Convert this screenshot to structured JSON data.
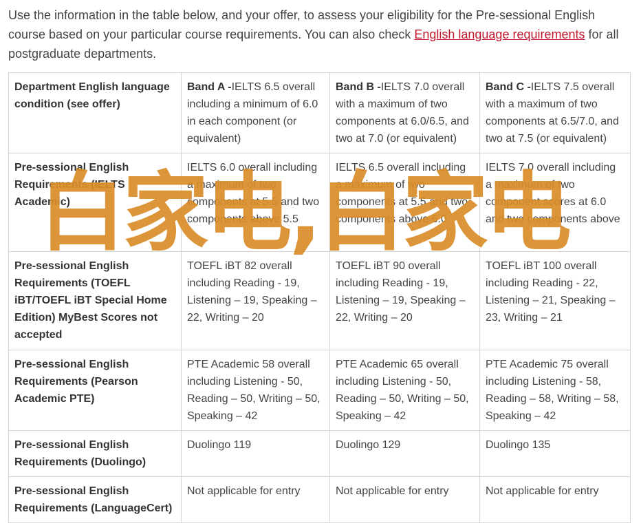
{
  "intro": {
    "before_link": "Use the information in the table below, and your offer, to assess your eligibility for the Pre-sessional English course based on your particular course requirements. You can also check ",
    "link_text": "English language requirements",
    "after_link": " for all postgraduate departments."
  },
  "table": {
    "header": {
      "first": "Department English language condition (see offer)",
      "bands": [
        {
          "label": "Band A -",
          "text": "IELTS 6.5 overall including a minimum of 6.0 in each component (or equivalent)"
        },
        {
          "label": "Band B -",
          "text": "IELTS 7.0 overall with a maximum of two components at 6.0/6.5, and two at 7.0 (or equivalent)"
        },
        {
          "label": "Band C -",
          "text": "IELTS 7.5 overall with a maximum of two components at 6.5/7.0, and two at 7.5 (or equivalent)"
        }
      ]
    },
    "rows": [
      {
        "label": "Pre-sessional English Requirements (IELTS Academic)",
        "cells": [
          "IELTS 6.0 overall including a maximum of two components at 5.5 and two components above 5.5",
          "IELTS 6.5 overall including a maximum of two components at 5.5 and two components above 6.0",
          "IELTS 7.0 overall including a maximum of two component scores at 6.0 and two components above"
        ]
      },
      {
        "label": "Pre-sessional English Requirements (TOEFL iBT/TOEFL iBT Special Home Edition) MyBest Scores not accepted",
        "cells": [
          "TOEFL iBT 82 overall including Reading - 19, Listening – 19, Speaking – 22, Writing – 20",
          "TOEFL iBT 90 overall including Reading - 19, Listening – 19, Speaking – 22, Writing – 20",
          "TOEFL iBT 100 overall including Reading - 22, Listening – 21, Speaking – 23, Writing – 21"
        ]
      },
      {
        "label": "Pre-sessional English Requirements (Pearson Academic PTE)",
        "cells": [
          "PTE Academic 58 overall including Listening - 50, Reading – 50, Writing – 50, Speaking – 42",
          "PTE Academic 65 overall including Listening - 50, Reading – 50, Writing – 50, Speaking – 42",
          "PTE Academic 75 overall including Listening - 58, Reading – 58, Writing – 58, Speaking – 42"
        ]
      },
      {
        "label": "Pre-sessional English Requirements (Duolingo)",
        "cells": [
          "Duolingo 119",
          "Duolingo 129",
          "Duolingo 135"
        ]
      },
      {
        "label": "Pre-sessional English Requirements (LanguageCert)",
        "cells": [
          "Not applicable for entry",
          "Not applicable for entry",
          "Not applicable for entry"
        ]
      }
    ]
  },
  "watermark": {
    "text": "白家电,白家电",
    "color": "#da8c28"
  }
}
